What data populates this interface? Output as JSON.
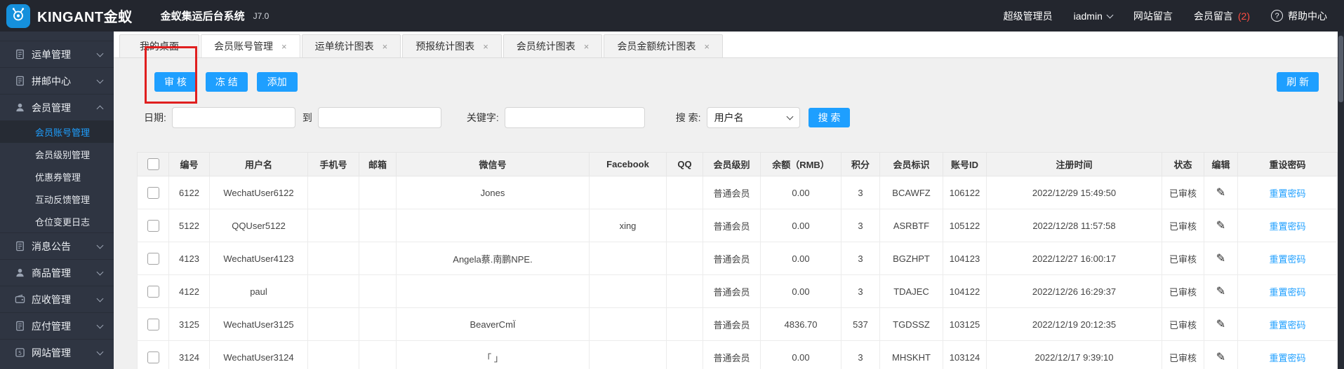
{
  "topbar": {
    "brand": "KINGANT金蚁",
    "system_title": "金蚁集运后台系统",
    "version": "J7.0",
    "role": "超级管理员",
    "username": "iadmin",
    "site_messages": "网站留言",
    "member_messages": "会员留言",
    "member_messages_count": "(2)",
    "help_glyph": "?",
    "help": "帮助中心"
  },
  "sidebar": {
    "groups": [
      {
        "label": "运单管理",
        "icon": "waybill-icon"
      },
      {
        "label": "拼邮中心",
        "icon": "mail-center-icon"
      },
      {
        "label": "会员管理",
        "icon": "member-icon",
        "expanded": true
      },
      {
        "label": "消息公告",
        "icon": "notice-icon"
      },
      {
        "label": "商品管理",
        "icon": "goods-icon"
      },
      {
        "label": "应收管理",
        "icon": "receivable-icon"
      },
      {
        "label": "应付管理",
        "icon": "payable-icon"
      },
      {
        "label": "网站管理",
        "icon": "website-icon"
      }
    ],
    "member_children": [
      {
        "label": "会员账号管理",
        "active": true
      },
      {
        "label": "会员级别管理",
        "active": false
      },
      {
        "label": "优惠券管理",
        "active": false
      },
      {
        "label": "互动反馈管理",
        "active": false
      },
      {
        "label": "仓位变更日志",
        "active": false
      }
    ]
  },
  "tabs": [
    {
      "label": "我的桌面",
      "closable": false,
      "active": false
    },
    {
      "label": "会员账号管理",
      "closable": true,
      "active": true
    },
    {
      "label": "运单统计图表",
      "closable": true,
      "active": false
    },
    {
      "label": "预报统计图表",
      "closable": true,
      "active": false
    },
    {
      "label": "会员统计图表",
      "closable": true,
      "active": false
    },
    {
      "label": "会员金额统计图表",
      "closable": true,
      "active": false
    }
  ],
  "close_glyph": "×",
  "toolbar": {
    "audit": "审 核",
    "freeze": "冻 结",
    "add": "添加",
    "refresh": "刷 新"
  },
  "filters": {
    "date_label": "日期:",
    "to_label": "到",
    "keyword_label": "关键字:",
    "search_label": "搜 索:",
    "search_select_value": "用户名",
    "search_button": "搜 索"
  },
  "table": {
    "headers": [
      "编号",
      "用户名",
      "手机号",
      "邮箱",
      "微信号",
      "Facebook",
      "QQ",
      "会员级别",
      "余额（RMB）",
      "积分",
      "会员标识",
      "账号ID",
      "注册时间",
      "状态",
      "编辑",
      "重设密码"
    ],
    "edit_icon": "✎",
    "reset_label": "重置密码",
    "rows": [
      {
        "id": "6122",
        "username": "WechatUser6122",
        "phone": "",
        "email": "",
        "wechat": "Jones",
        "facebook": "",
        "qq": "",
        "level": "普通会员",
        "balance": "0.00",
        "points": "3",
        "tag": "BCAWFZ",
        "account_id": "106122",
        "reg_time": "2022/12/29 15:49:50",
        "status": "已审核"
      },
      {
        "id": "5122",
        "username": "QQUser5122",
        "phone": "",
        "email": "",
        "wechat": "",
        "facebook": "xing",
        "qq": "",
        "level": "普通会员",
        "balance": "0.00",
        "points": "3",
        "tag": "ASRBTF",
        "account_id": "105122",
        "reg_time": "2022/12/28 11:57:58",
        "status": "已审核"
      },
      {
        "id": "4123",
        "username": "WechatUser4123",
        "phone": "",
        "email": "",
        "wechat": "Angela蔡.南鹏NPE.",
        "facebook": "",
        "qq": "",
        "level": "普通会员",
        "balance": "0.00",
        "points": "3",
        "tag": "BGZHPT",
        "account_id": "104123",
        "reg_time": "2022/12/27 16:00:17",
        "status": "已审核"
      },
      {
        "id": "4122",
        "username": "paul",
        "phone": "",
        "email": "",
        "wechat": "",
        "facebook": "",
        "qq": "",
        "level": "普通会员",
        "balance": "0.00",
        "points": "3",
        "tag": "TDAJEC",
        "account_id": "104122",
        "reg_time": "2022/12/26 16:29:37",
        "status": "已审核"
      },
      {
        "id": "3125",
        "username": "WechatUser3125",
        "phone": "",
        "email": "",
        "wechat": "BeaverCmÏ",
        "facebook": "",
        "qq": "",
        "level": "普通会员",
        "balance": "4836.70",
        "points": "537",
        "tag": "TGDSSZ",
        "account_id": "103125",
        "reg_time": "2022/12/19 20:12:35",
        "status": "已审核"
      },
      {
        "id": "3124",
        "username": "WechatUser3124",
        "phone": "",
        "email": "",
        "wechat": "「 」",
        "facebook": "",
        "qq": "",
        "level": "普通会员",
        "balance": "0.00",
        "points": "3",
        "tag": "MHSKHT",
        "account_id": "103124",
        "reg_time": "2022/12/17 9:39:10",
        "status": "已审核"
      }
    ]
  },
  "colors": {
    "accent": "#1e9fff",
    "topbar_bg": "#23262e",
    "sidebar_bg": "#2f3542",
    "badge_red": "#ff4d42",
    "annotation_red": "#e01f1f",
    "link_blue": "#1e9fff"
  }
}
